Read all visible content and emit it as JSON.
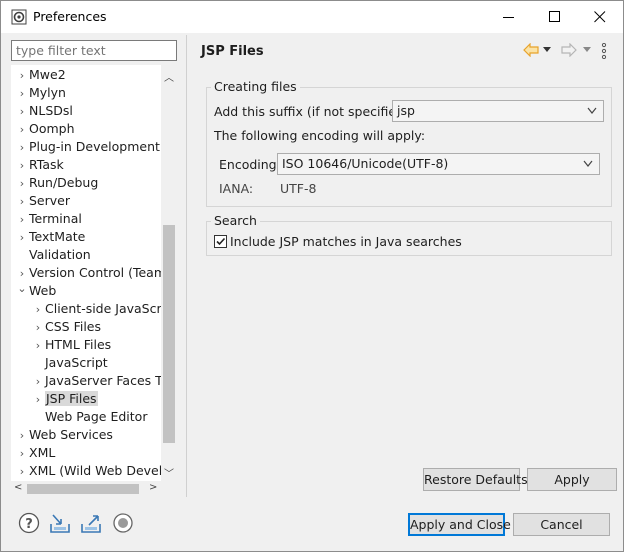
{
  "window": {
    "title": "Preferences"
  },
  "filter": {
    "placeholder": "type filter text"
  },
  "tree": {
    "items": [
      {
        "label": "Mwe2",
        "level": 0,
        "expandable": true
      },
      {
        "label": "Mylyn",
        "level": 0,
        "expandable": true
      },
      {
        "label": "NLSDsl",
        "level": 0,
        "expandable": true
      },
      {
        "label": "Oomph",
        "level": 0,
        "expandable": true
      },
      {
        "label": "Plug-in Development",
        "level": 0,
        "expandable": true
      },
      {
        "label": "RTask",
        "level": 0,
        "expandable": true
      },
      {
        "label": "Run/Debug",
        "level": 0,
        "expandable": true
      },
      {
        "label": "Server",
        "level": 0,
        "expandable": true
      },
      {
        "label": "Terminal",
        "level": 0,
        "expandable": true
      },
      {
        "label": "TextMate",
        "level": 0,
        "expandable": true
      },
      {
        "label": "Validation",
        "level": 0,
        "expandable": false
      },
      {
        "label": "Version Control (Team)",
        "level": 0,
        "expandable": true
      },
      {
        "label": "Web",
        "level": 0,
        "expandable": true,
        "expanded": true
      },
      {
        "label": "Client-side JavaScript",
        "level": 1,
        "expandable": true
      },
      {
        "label": "CSS Files",
        "level": 1,
        "expandable": true
      },
      {
        "label": "HTML Files",
        "level": 1,
        "expandable": true
      },
      {
        "label": "JavaScript",
        "level": 1,
        "expandable": false
      },
      {
        "label": "JavaServer Faces Tools",
        "level": 1,
        "expandable": true
      },
      {
        "label": "JSP Files",
        "level": 1,
        "expandable": true,
        "selected": true
      },
      {
        "label": "Web Page Editor",
        "level": 1,
        "expandable": false
      },
      {
        "label": "Web Services",
        "level": 0,
        "expandable": true
      },
      {
        "label": "XML",
        "level": 0,
        "expandable": true
      },
      {
        "label": "XML (Wild Web Developer)",
        "level": 0,
        "expandable": true
      }
    ]
  },
  "page": {
    "title": "JSP Files",
    "creating": {
      "legend": "Creating files",
      "suffix_label": "Add this suffix (if not specified):",
      "suffix_value": "jsp",
      "encoding_note": "The following encoding will apply:",
      "encoding_label": "Encoding:",
      "encoding_value": "ISO 10646/Unicode(UTF-8)",
      "iana_label": "IANA:",
      "iana_value": "UTF-8"
    },
    "search": {
      "legend": "Search",
      "checkbox_label": "Include JSP matches in Java searches",
      "checked": true
    }
  },
  "buttons": {
    "restore_defaults": "Restore Defaults",
    "apply": "Apply",
    "apply_and_close": "Apply and Close",
    "cancel": "Cancel"
  },
  "icons": {
    "help": "help-icon",
    "import": "import-icon",
    "export": "export-icon",
    "record": "record-icon",
    "back": "back-arrow-icon",
    "forward": "forward-arrow-icon",
    "menu": "view-menu-icon"
  },
  "colors": {
    "accent": "#0078d7",
    "back_arrow": "#e8a32a",
    "selection": "#d9d9d9"
  }
}
